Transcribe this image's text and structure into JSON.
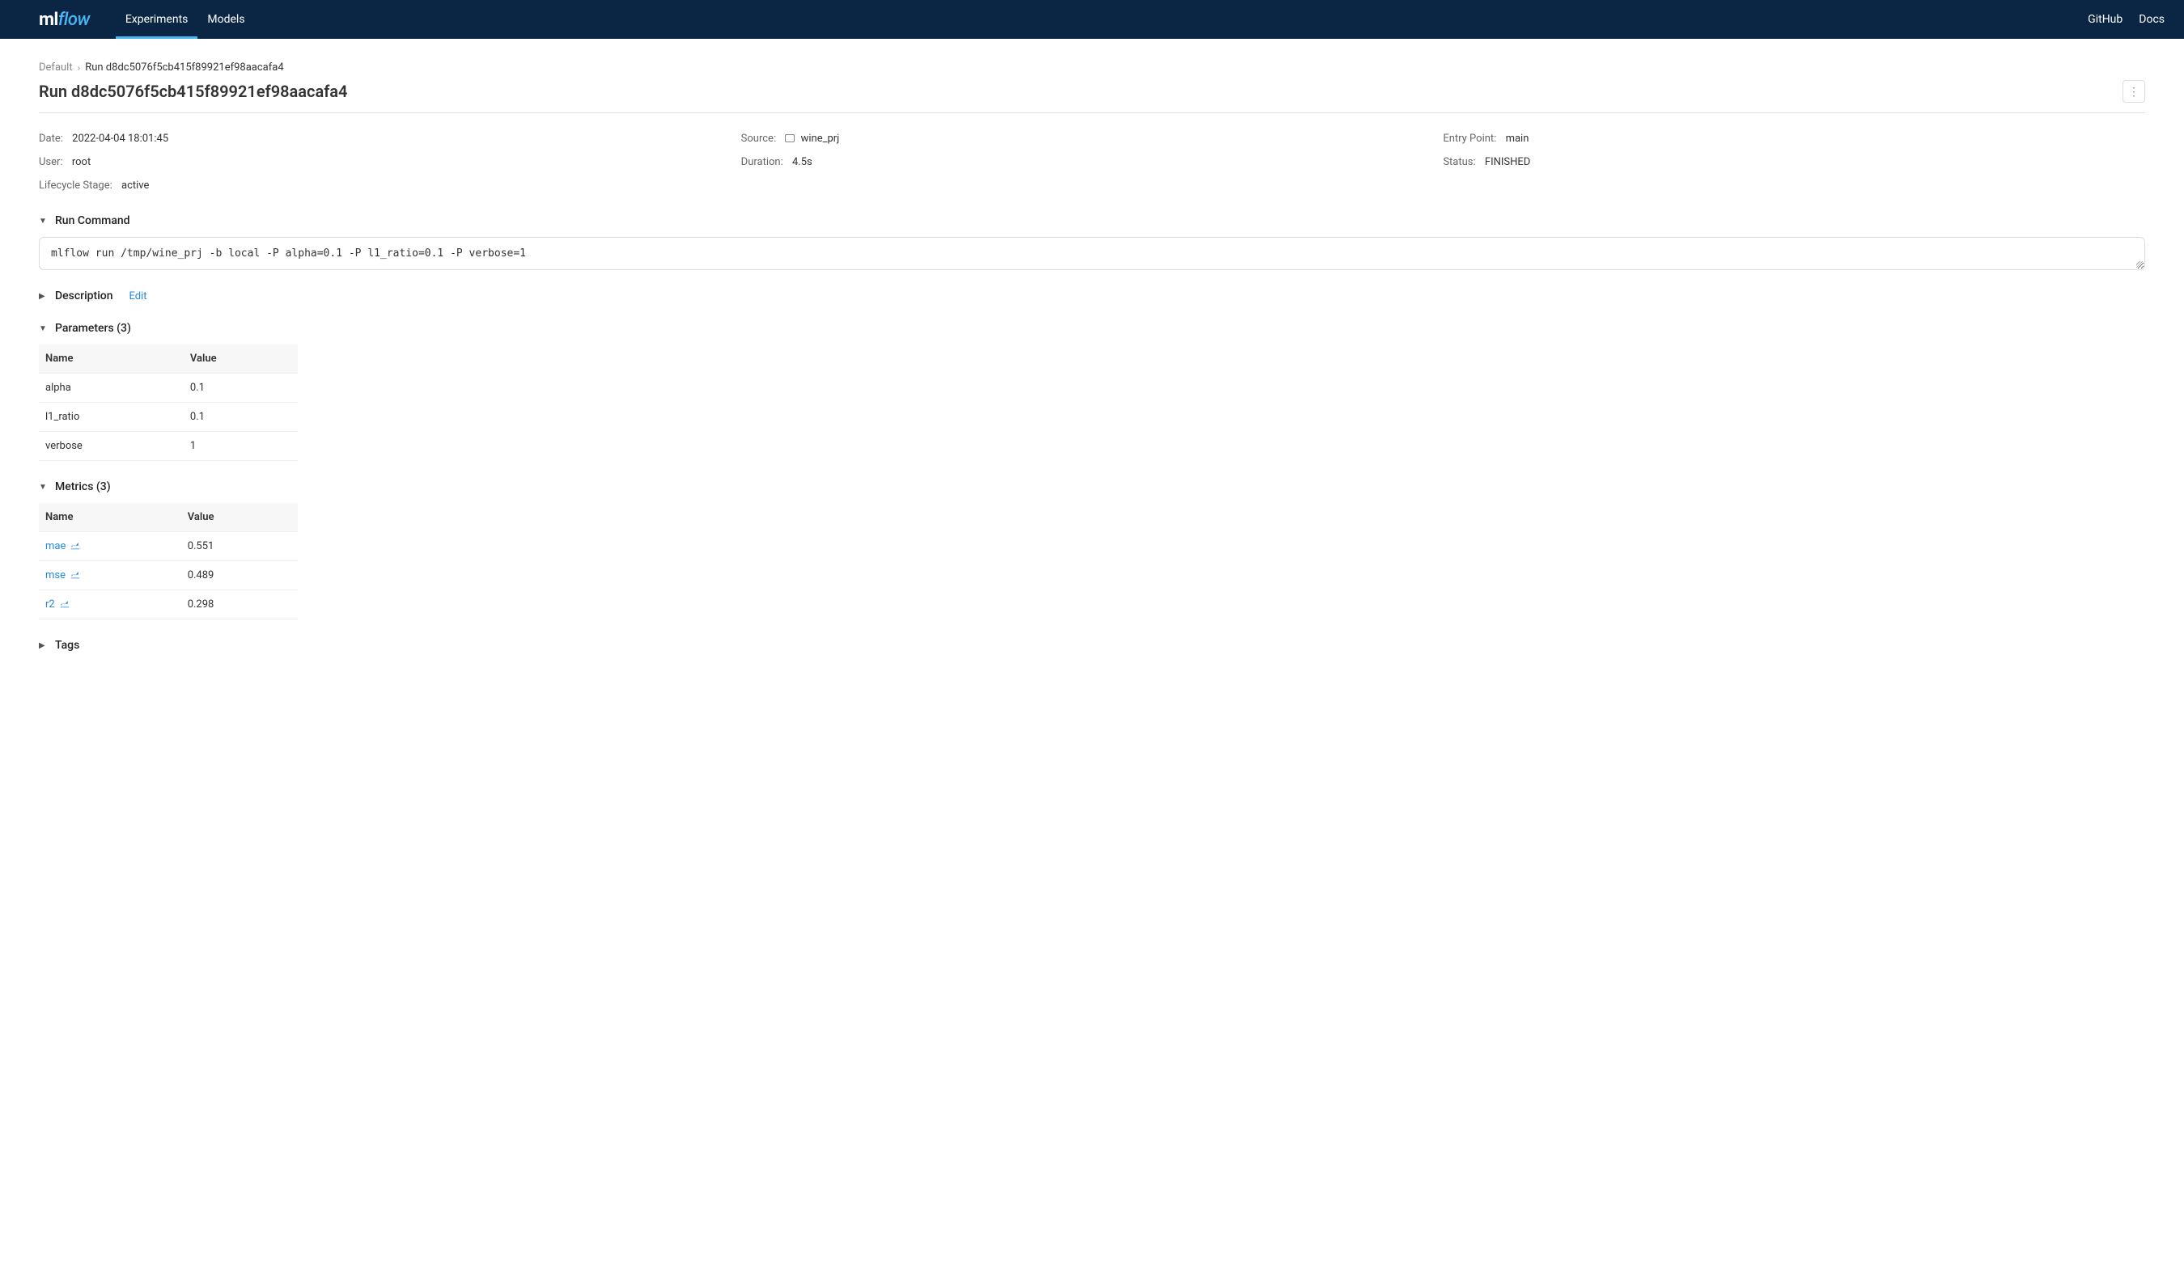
{
  "topbar": {
    "logo_ml": "ml",
    "logo_flow": "flow",
    "tabs": [
      {
        "label": "Experiments",
        "active": true
      },
      {
        "label": "Models",
        "active": false
      }
    ],
    "links": [
      {
        "label": "GitHub"
      },
      {
        "label": "Docs"
      }
    ]
  },
  "breadcrumb": {
    "root": "Default",
    "current": "Run d8dc5076f5cb415f89921ef98aacafa4"
  },
  "page_title": "Run d8dc5076f5cb415f89921ef98aacafa4",
  "meta": {
    "date_label": "Date",
    "date_value": "2022-04-04 18:01:45",
    "source_label": "Source",
    "source_value": "wine_prj",
    "entry_label": "Entry Point",
    "entry_value": "main",
    "user_label": "User",
    "user_value": "root",
    "duration_label": "Duration",
    "duration_value": "4.5s",
    "status_label": "Status",
    "status_value": "FINISHED",
    "stage_label": "Lifecycle Stage",
    "stage_value": "active"
  },
  "sections": {
    "run_command": {
      "title": "Run Command",
      "value": "mlflow run /tmp/wine_prj -b local -P alpha=0.1 -P l1_ratio=0.1 -P verbose=1"
    },
    "description": {
      "title": "Description",
      "edit": "Edit"
    },
    "parameters": {
      "title": "Parameters (3)",
      "col1": "Name",
      "col2": "Value",
      "rows": [
        {
          "name": "alpha",
          "value": "0.1"
        },
        {
          "name": "l1_ratio",
          "value": "0.1"
        },
        {
          "name": "verbose",
          "value": "1"
        }
      ]
    },
    "metrics": {
      "title": "Metrics (3)",
      "col1": "Name",
      "col2": "Value",
      "rows": [
        {
          "name": "mae",
          "value": "0.551"
        },
        {
          "name": "mse",
          "value": "0.489"
        },
        {
          "name": "r2",
          "value": "0.298"
        }
      ]
    },
    "tags": {
      "title": "Tags"
    }
  }
}
